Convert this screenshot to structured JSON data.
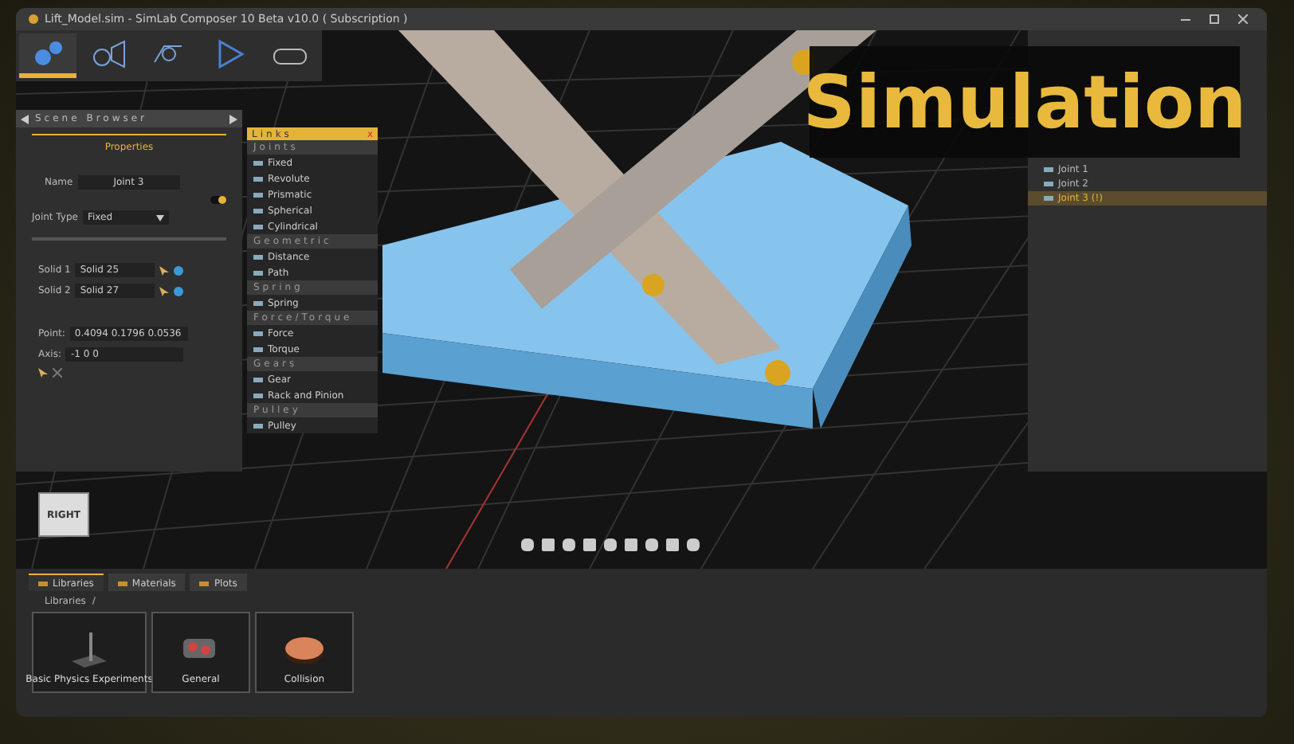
{
  "window": {
    "title": "Lift_Model.sim - SimLab Composer 10 Beta v10.0 ( Subscription )"
  },
  "scene_browser": {
    "title": "Scene Browser",
    "heading": "Properties",
    "name": {
      "label": "Name",
      "value": "Joint 3"
    },
    "toggle": {
      "on": true
    },
    "joint_type": {
      "label": "Joint Type",
      "value": "Fixed"
    },
    "solids": [
      {
        "label": "Solid 1",
        "value": "Solid 25"
      },
      {
        "label": "Solid 2",
        "value": "Solid 27"
      }
    ],
    "point": {
      "label": "Point:",
      "value": "0.4094 0.1796 0.0536"
    },
    "axis": {
      "label": "Axis:",
      "value": "-1 0 0"
    }
  },
  "links_menu": {
    "title": "Links",
    "close": "x",
    "sections": [
      {
        "title": "Joints",
        "items": [
          "Fixed",
          "Revolute",
          "Prismatic",
          "Spherical",
          "Cylindrical"
        ]
      },
      {
        "title": "Geometric",
        "items": [
          "Distance",
          "Path"
        ]
      },
      {
        "title": "Spring",
        "items": [
          "Spring"
        ]
      },
      {
        "title": "Force/Torque",
        "items": [
          "Force",
          "Torque"
        ]
      },
      {
        "title": "Gears",
        "items": [
          "Gear",
          "Rack and Pinion"
        ]
      },
      {
        "title": "Pulley",
        "items": [
          "Pulley"
        ]
      }
    ]
  },
  "tree": {
    "items": [
      {
        "label": "Joint 1",
        "selected": false
      },
      {
        "label": "Joint 2",
        "selected": false
      },
      {
        "label": "Joint 3 (!)",
        "selected": true
      }
    ]
  },
  "banner": {
    "text": "Simulation"
  },
  "cube": {
    "label": "RIGHT"
  },
  "bottom_panel": {
    "tabs": [
      {
        "label": "Libraries",
        "selected": true
      },
      {
        "label": "Materials",
        "selected": false
      },
      {
        "label": "Plots",
        "selected": false
      }
    ],
    "breadcrumb": [
      "Libraries",
      "/"
    ],
    "cards": [
      {
        "label": "Basic Physics Experiments",
        "kind": "stand"
      },
      {
        "label": "General",
        "kind": "gears"
      },
      {
        "label": "Collision",
        "kind": "disc"
      }
    ]
  }
}
